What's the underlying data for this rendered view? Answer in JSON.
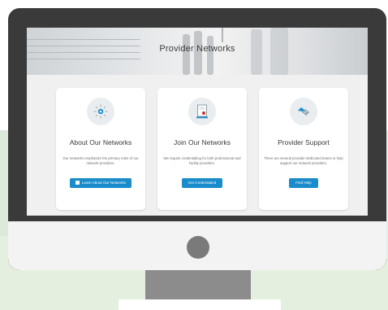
{
  "banner": {
    "title": "Provider Networks"
  },
  "cards": [
    {
      "title": "About Our Networks",
      "description": "Our networks emphasize the primary roles of our network providers.",
      "button_label": "Learn About Our Networks"
    },
    {
      "title": "Join Our Networks",
      "description": "We require credentialing for both professional and facility providers.",
      "button_label": "Get Credentialed"
    },
    {
      "title": "Provider Support",
      "description": "There are several provider-dedicated teams to help support our network providers.",
      "button_label": "Find Help"
    }
  ],
  "colors": {
    "accent": "#1a8ccb",
    "bezel": "#3a3a3a",
    "background_green": "#e4efdf",
    "icon_circle": "#e9edef"
  },
  "icons": {
    "card_1": "network-icon",
    "card_2": "certificate-icon",
    "card_3": "handshake-icon"
  }
}
